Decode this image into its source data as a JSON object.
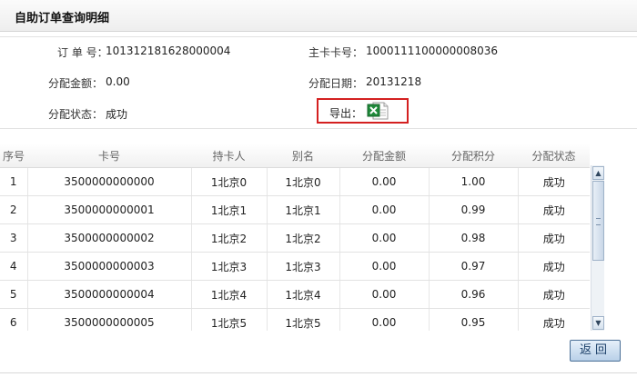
{
  "header": {
    "title": "自助订单查询明细"
  },
  "info": {
    "order_label": "订 单 号：",
    "order_value": "101312181628000004",
    "card_label": "主卡卡号：",
    "card_value": "1000111100000008036",
    "amount_label": "分配金额：",
    "amount_value": "0.00",
    "date_label": "分配日期：",
    "date_value": "20131218",
    "status_label": "分配状态：",
    "status_value": "成功",
    "export_label": "导出："
  },
  "table": {
    "columns": [
      "序号",
      "卡号",
      "持卡人",
      "别名",
      "分配金额",
      "分配积分",
      "分配状态"
    ],
    "rows": [
      [
        "1",
        "3500000000000",
        "1北京0",
        "1北京0",
        "0.00",
        "1.00",
        "成功"
      ],
      [
        "2",
        "3500000000001",
        "1北京1",
        "1北京1",
        "0.00",
        "0.99",
        "成功"
      ],
      [
        "3",
        "3500000000002",
        "1北京2",
        "1北京2",
        "0.00",
        "0.98",
        "成功"
      ],
      [
        "4",
        "3500000000003",
        "1北京3",
        "1北京3",
        "0.00",
        "0.97",
        "成功"
      ],
      [
        "5",
        "3500000000004",
        "1北京4",
        "1北京4",
        "0.00",
        "0.96",
        "成功"
      ],
      [
        "6",
        "3500000000005",
        "1北京5",
        "1北京5",
        "0.00",
        "0.95",
        "成功"
      ]
    ]
  },
  "icons": {
    "export": "excel-icon",
    "scroll_up": "chevron-up-icon",
    "scroll_down": "chevron-down-icon"
  },
  "colors": {
    "highlight": "#d42020",
    "button_border": "#4a6f96"
  },
  "actions": {
    "back_label": "返回"
  }
}
